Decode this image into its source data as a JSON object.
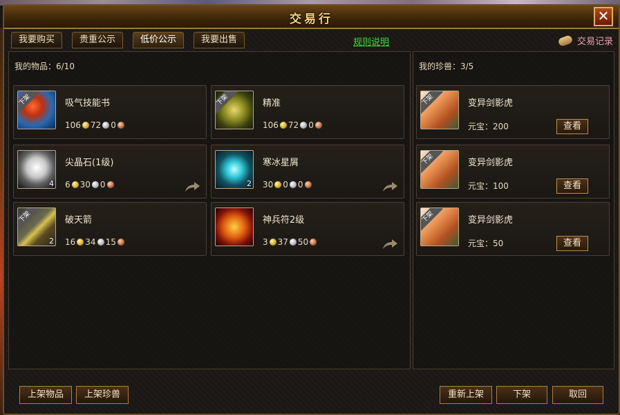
{
  "window": {
    "title": "交易行",
    "close_label": "✕"
  },
  "tabs": [
    {
      "label": "我要购买"
    },
    {
      "label": "贵重公示"
    },
    {
      "label": "低价公示"
    },
    {
      "label": "我要出售"
    }
  ],
  "rules_link": "规则说明",
  "trade_log": "交易记录",
  "items_panel": {
    "title": "我的物品：6/10",
    "items": [
      {
        "name": "吸气技能书",
        "gold": "106",
        "silver": "72",
        "copper": "0",
        "badge": "下架",
        "count": "",
        "icon": "skill-book-icon",
        "share": false
      },
      {
        "name": "精准",
        "gold": "106",
        "silver": "72",
        "copper": "0",
        "badge": "下架",
        "count": "",
        "icon": "compass-icon",
        "share": false
      },
      {
        "name": "尖晶石(1级)",
        "gold": "6",
        "silver": "30",
        "copper": "0",
        "badge": "",
        "count": "4",
        "icon": "gem-icon",
        "share": true
      },
      {
        "name": "寒冰星屑",
        "gold": "30",
        "silver": "0",
        "copper": "0",
        "badge": "",
        "count": "2",
        "icon": "ice-dust-icon",
        "share": true
      },
      {
        "name": "破天箭",
        "gold": "16",
        "silver": "34",
        "copper": "15",
        "badge": "下架",
        "count": "2",
        "icon": "arrow-icon",
        "share": false
      },
      {
        "name": "神兵符2级",
        "gold": "3",
        "silver": "37",
        "copper": "50",
        "badge": "",
        "count": "",
        "icon": "dragon-talisman-icon",
        "share": true
      }
    ]
  },
  "pets_panel": {
    "title": "我的珍兽：3/5",
    "pets": [
      {
        "name": "变异剑影虎",
        "price_label": "元宝：200",
        "badge": "下架",
        "view_label": "查看"
      },
      {
        "name": "变异剑影虎",
        "price_label": "元宝：100",
        "badge": "下架",
        "view_label": "查看"
      },
      {
        "name": "变异剑影虎",
        "price_label": "元宝：50",
        "badge": "下架",
        "view_label": "查看"
      }
    ]
  },
  "bottom": {
    "list_item": "上架物品",
    "list_pet": "上架珍兽",
    "relist": "重新上架",
    "delist": "下架",
    "cancel": "取回"
  }
}
